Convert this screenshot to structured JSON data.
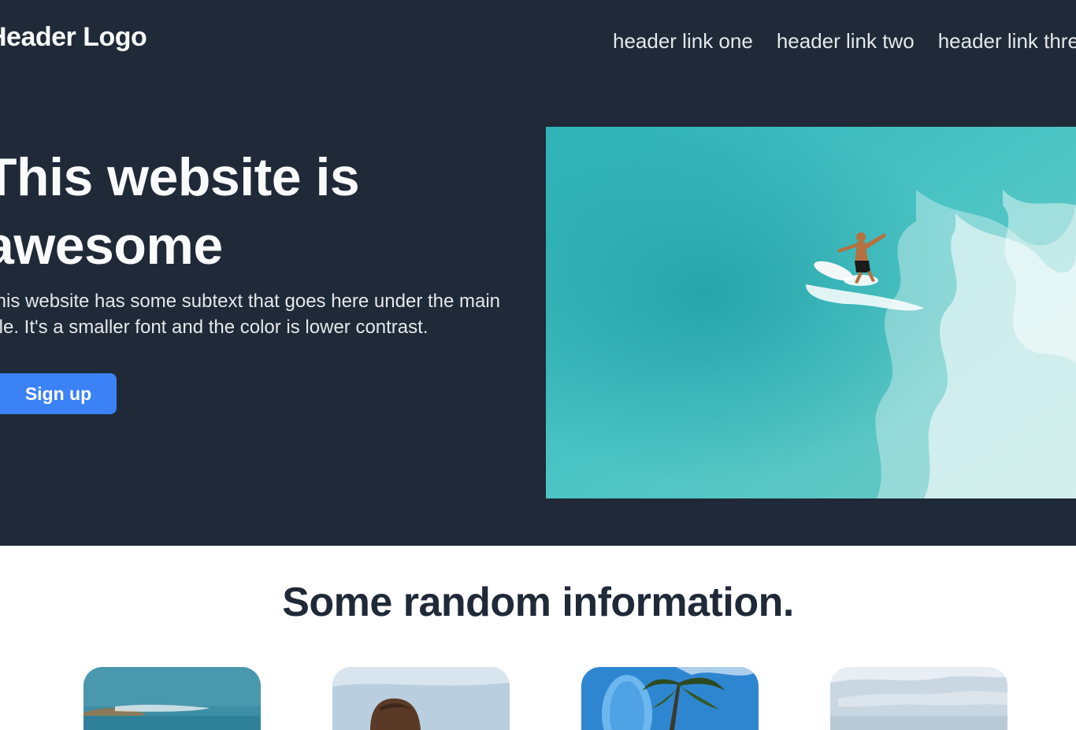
{
  "header": {
    "logo": "Header Logo",
    "links": [
      "header link one",
      "header link two",
      "header link three"
    ]
  },
  "hero": {
    "title": "This website is awesome",
    "subtext": "This website has some subtext that goes here under the main title. It's a smaller font and the color is lower contrast.",
    "button_label": "Sign up",
    "image": "surfer-aerial-photo"
  },
  "info": {
    "title": "Some random information.",
    "cards": [
      {
        "image": "beach-photo"
      },
      {
        "image": "person-photo"
      },
      {
        "image": "surfboard-palm-photo"
      },
      {
        "image": "cloudy-sky-photo"
      }
    ]
  },
  "colors": {
    "hero_bg": "#1f2937",
    "accent": "#3b82f6",
    "heading_dark": "#1f2937"
  }
}
